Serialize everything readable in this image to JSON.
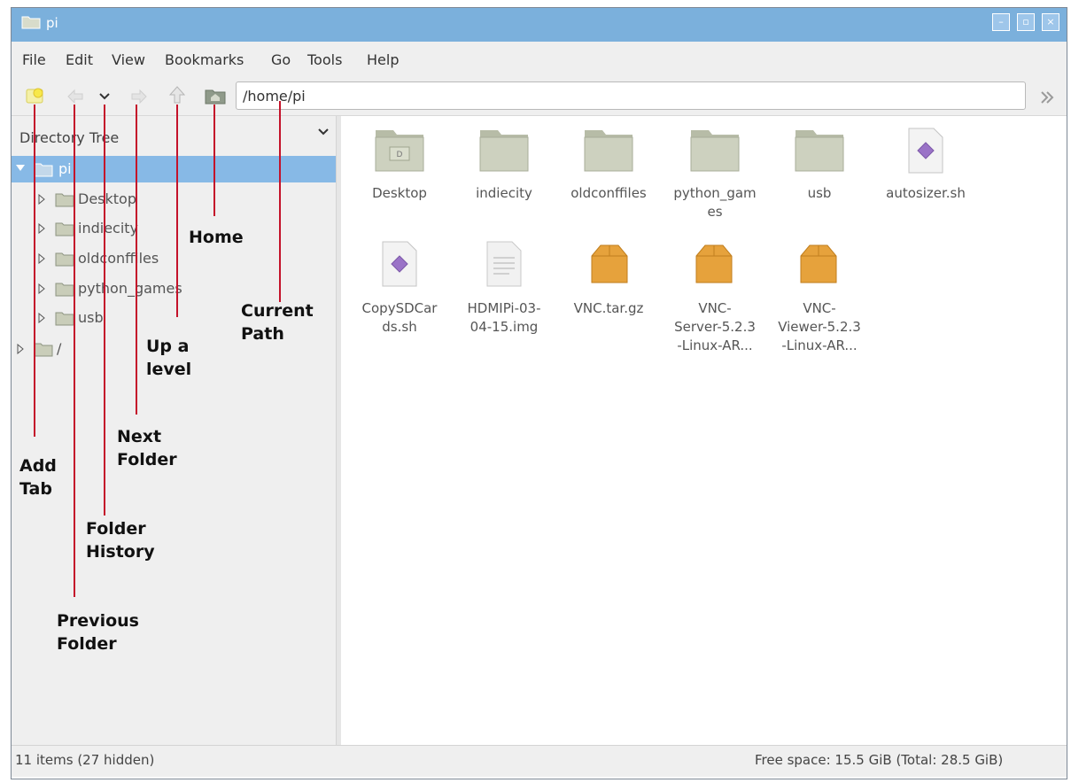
{
  "window": {
    "title": "pi",
    "controls": {
      "minimize": "–",
      "maximize": "▫",
      "close": "×"
    }
  },
  "menu": [
    "File",
    "Edit",
    "View",
    "Bookmarks",
    "Go",
    "Tools",
    "Help"
  ],
  "toolbar": {
    "path": "/home/pi",
    "buttons": [
      "new-tab",
      "back",
      "history",
      "forward",
      "up",
      "home",
      "go"
    ]
  },
  "sidebar": {
    "title": "Directory Tree",
    "tree": [
      {
        "label": "pi",
        "expanded": true,
        "selected": true,
        "icon": "home-folder-icon"
      },
      {
        "label": "Desktop",
        "indent": 1,
        "icon": "desktop-folder-icon"
      },
      {
        "label": "indiecity",
        "indent": 1,
        "icon": "folder-icon"
      },
      {
        "label": "oldconffiles",
        "indent": 1,
        "icon": "folder-icon"
      },
      {
        "label": "python_games",
        "indent": 1,
        "icon": "folder-icon"
      },
      {
        "label": "usb",
        "indent": 1,
        "icon": "folder-icon"
      },
      {
        "label": "/",
        "indent": 0,
        "icon": "drive-folder-icon"
      }
    ]
  },
  "files": [
    {
      "label": "Desktop",
      "icon": "desktop-folder-icon"
    },
    {
      "label": "indiecity",
      "icon": "folder-icon"
    },
    {
      "label": "oldconffiles",
      "icon": "folder-icon"
    },
    {
      "label": "python_gam\nes",
      "icon": "folder-icon"
    },
    {
      "label": "usb",
      "icon": "folder-icon"
    },
    {
      "label": "autosizer.sh",
      "icon": "script-file-icon"
    },
    {
      "label": "CopySDCar\nds.sh",
      "icon": "script-file-icon"
    },
    {
      "label": "HDMIPi-03-\n04-15.img",
      "icon": "text-file-icon"
    },
    {
      "label": "VNC.tar.gz",
      "icon": "archive-icon"
    },
    {
      "label": "VNC-\nServer-5.2.3\n-Linux-AR...",
      "icon": "archive-icon"
    },
    {
      "label": "VNC-\nViewer-5.2.3\n-Linux-AR...",
      "icon": "archive-icon"
    }
  ],
  "status": {
    "left": "11 items (27 hidden)",
    "right": "Free space: 15.5 GiB (Total: 28.5 GiB)"
  },
  "annotations": {
    "home": "Home",
    "current_path": "Current\nPath",
    "up_level": "Up a\nlevel",
    "next_folder": "Next\nFolder",
    "add_tab": "Add\nTab",
    "folder_history": "Folder\nHistory",
    "previous_folder": "Previous\nFolder"
  },
  "colors": {
    "titlebar": "#7bb0dc",
    "selection": "#87b9e6",
    "folder": "#c9cdb9",
    "archive": "#e6a23c",
    "annotation_line": "#c4122a"
  }
}
